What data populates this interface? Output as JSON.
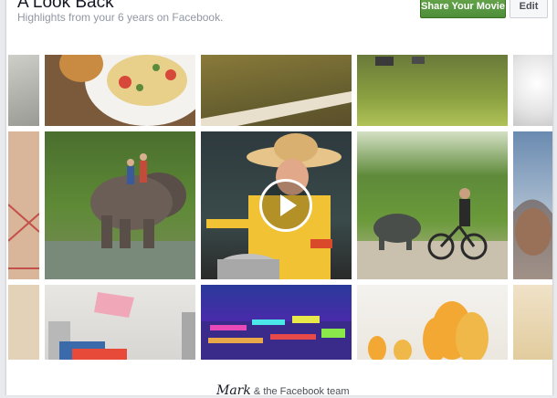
{
  "header": {
    "title": "A Look Back",
    "subtitle": "Highlights from your 6 years on Facebook.",
    "share_label": "Share Your Movie",
    "edit_label": "Edit"
  },
  "grid": {
    "play_icon": "play-icon",
    "photos": [
      "photo-sidewalk",
      "photo-food-plate",
      "photo-grass-path",
      "photo-field",
      "photo-white-flowers",
      "photo-tile-floor",
      "photo-elephant",
      "photo-cowboy-hat-cooking",
      "photo-bicycle-buffalo",
      "photo-woman-smiling",
      "photo-desk-left",
      "photo-desk-pink-paper",
      "photo-led-sign",
      "photo-orange-flowers",
      "photo-right-edge"
    ]
  },
  "footer": {
    "signature": "Mark",
    "text": "& the Facebook team"
  },
  "colors": {
    "share_button": "#4e8f3a",
    "background": "#e9eaed"
  }
}
